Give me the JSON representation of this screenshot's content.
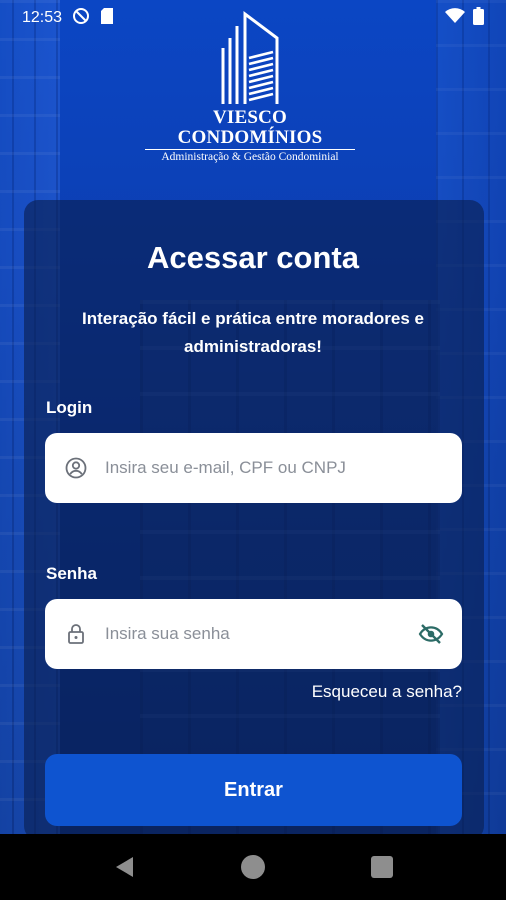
{
  "status_bar": {
    "time": "12:53",
    "icons": [
      "do-not-disturb-icon",
      "sim-card-icon",
      "wifi-icon",
      "battery-icon"
    ]
  },
  "logo": {
    "brand": "VIESCO CONDOMÍNIOS",
    "tagline": "Administração & Gestão Condominial"
  },
  "login_card": {
    "title": "Acessar conta",
    "subtitle": "Interação fácil e prática entre moradores e administradoras!",
    "login_label": "Login",
    "login_placeholder": "Insira seu e-mail, CPF ou CNPJ",
    "login_value": "",
    "password_label": "Senha",
    "password_placeholder": "Insira sua senha",
    "password_value": "",
    "forgot_password": "Esqueceu a senha?",
    "submit": "Entrar"
  },
  "colors": {
    "primary": "#0e54d0",
    "background": "#0b46c4",
    "card": "#091e50"
  },
  "navigation": {
    "back": "back-icon",
    "home": "home-icon",
    "recents": "recents-icon"
  }
}
